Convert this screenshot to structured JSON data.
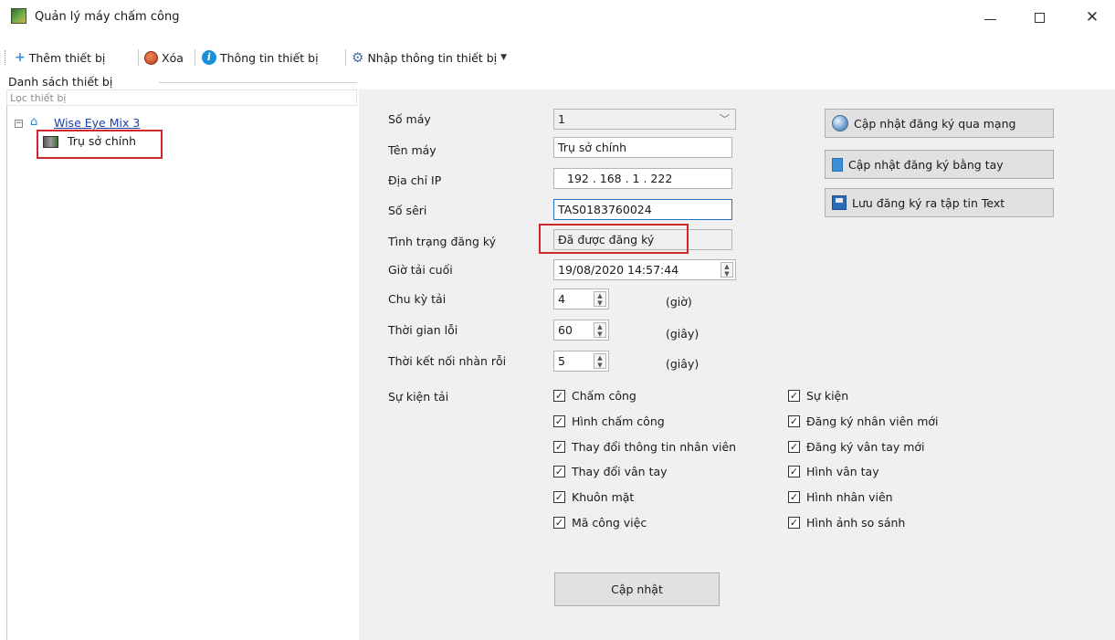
{
  "window": {
    "title": "Quản lý máy chấm công",
    "minimize_glyph": "—",
    "close_glyph": "✕"
  },
  "toolbar": {
    "add_label": "Thêm thiết bị",
    "delete_label": "Xóa",
    "info_label": "Thông tin thiết bị",
    "import_label": "Nhập thông tin thiết bị",
    "icons": [
      "plus-icon",
      "delete-icon",
      "info-icon",
      "gear-icon",
      "caret-down-icon"
    ]
  },
  "left_panel": {
    "group_title": "Danh sách thiết bị",
    "filter_placeholder": "Lọc thiết bị",
    "tree": {
      "root_label": "Wise Eye Mix 3",
      "child_label": "Trụ sở chính"
    }
  },
  "form": {
    "machine_no": {
      "label": "Số máy",
      "value": "1"
    },
    "machine_name": {
      "label": "Tên máy",
      "value": "Trụ sở chính"
    },
    "ip": {
      "label": "Địa chỉ IP",
      "value": "192 . 168 . 1 . 222"
    },
    "serial": {
      "label": "Số sêri",
      "value": "TAS0183760024"
    },
    "reg_status": {
      "label": "Tình trạng đăng ký",
      "value": "Đã được đăng ký"
    },
    "last_download": {
      "label": "Giờ tải cuối",
      "value": "19/08/2020 14:57:44"
    },
    "download_cycle": {
      "label": "Chu kỳ tải",
      "value": "4",
      "unit": "(giờ)"
    },
    "error_time": {
      "label": "Thời gian lỗi",
      "value": "60",
      "unit": "(giây)"
    },
    "idle_timeout": {
      "label": "Thời kết nối nhàn rỗi",
      "value": "5",
      "unit": "(giây)"
    },
    "events_label": "Sự kiện tải"
  },
  "events": {
    "left": [
      {
        "label": "Chấm công",
        "checked": true
      },
      {
        "label": "Hình chấm công",
        "checked": true
      },
      {
        "label": "Thay đổi thông tin nhân viên",
        "checked": true
      },
      {
        "label": "Thay đổi vân tay",
        "checked": true
      },
      {
        "label": "Khuôn mặt",
        "checked": true
      },
      {
        "label": "Mã công việc",
        "checked": true
      }
    ],
    "right": [
      {
        "label": "Sự kiện",
        "checked": true
      },
      {
        "label": "Đăng ký nhân viên mới",
        "checked": true
      },
      {
        "label": "Đăng ký vân tay mới",
        "checked": true
      },
      {
        "label": "Hình vân tay",
        "checked": true
      },
      {
        "label": "Hình nhân viên",
        "checked": true
      },
      {
        "label": "Hình ảnh so sánh",
        "checked": true
      }
    ]
  },
  "actions": {
    "online_update": "Cập nhật đăng ký qua mạng",
    "manual_update": "Cập nhật đăng ký bằng tay",
    "save_text": "Lưu đăng ký ra tập tin Text",
    "update": "Cập nhật"
  },
  "colors": {
    "highlight": "#d0262d",
    "link": "#1a3fa6",
    "panel_bg": "#f0f0f0"
  }
}
